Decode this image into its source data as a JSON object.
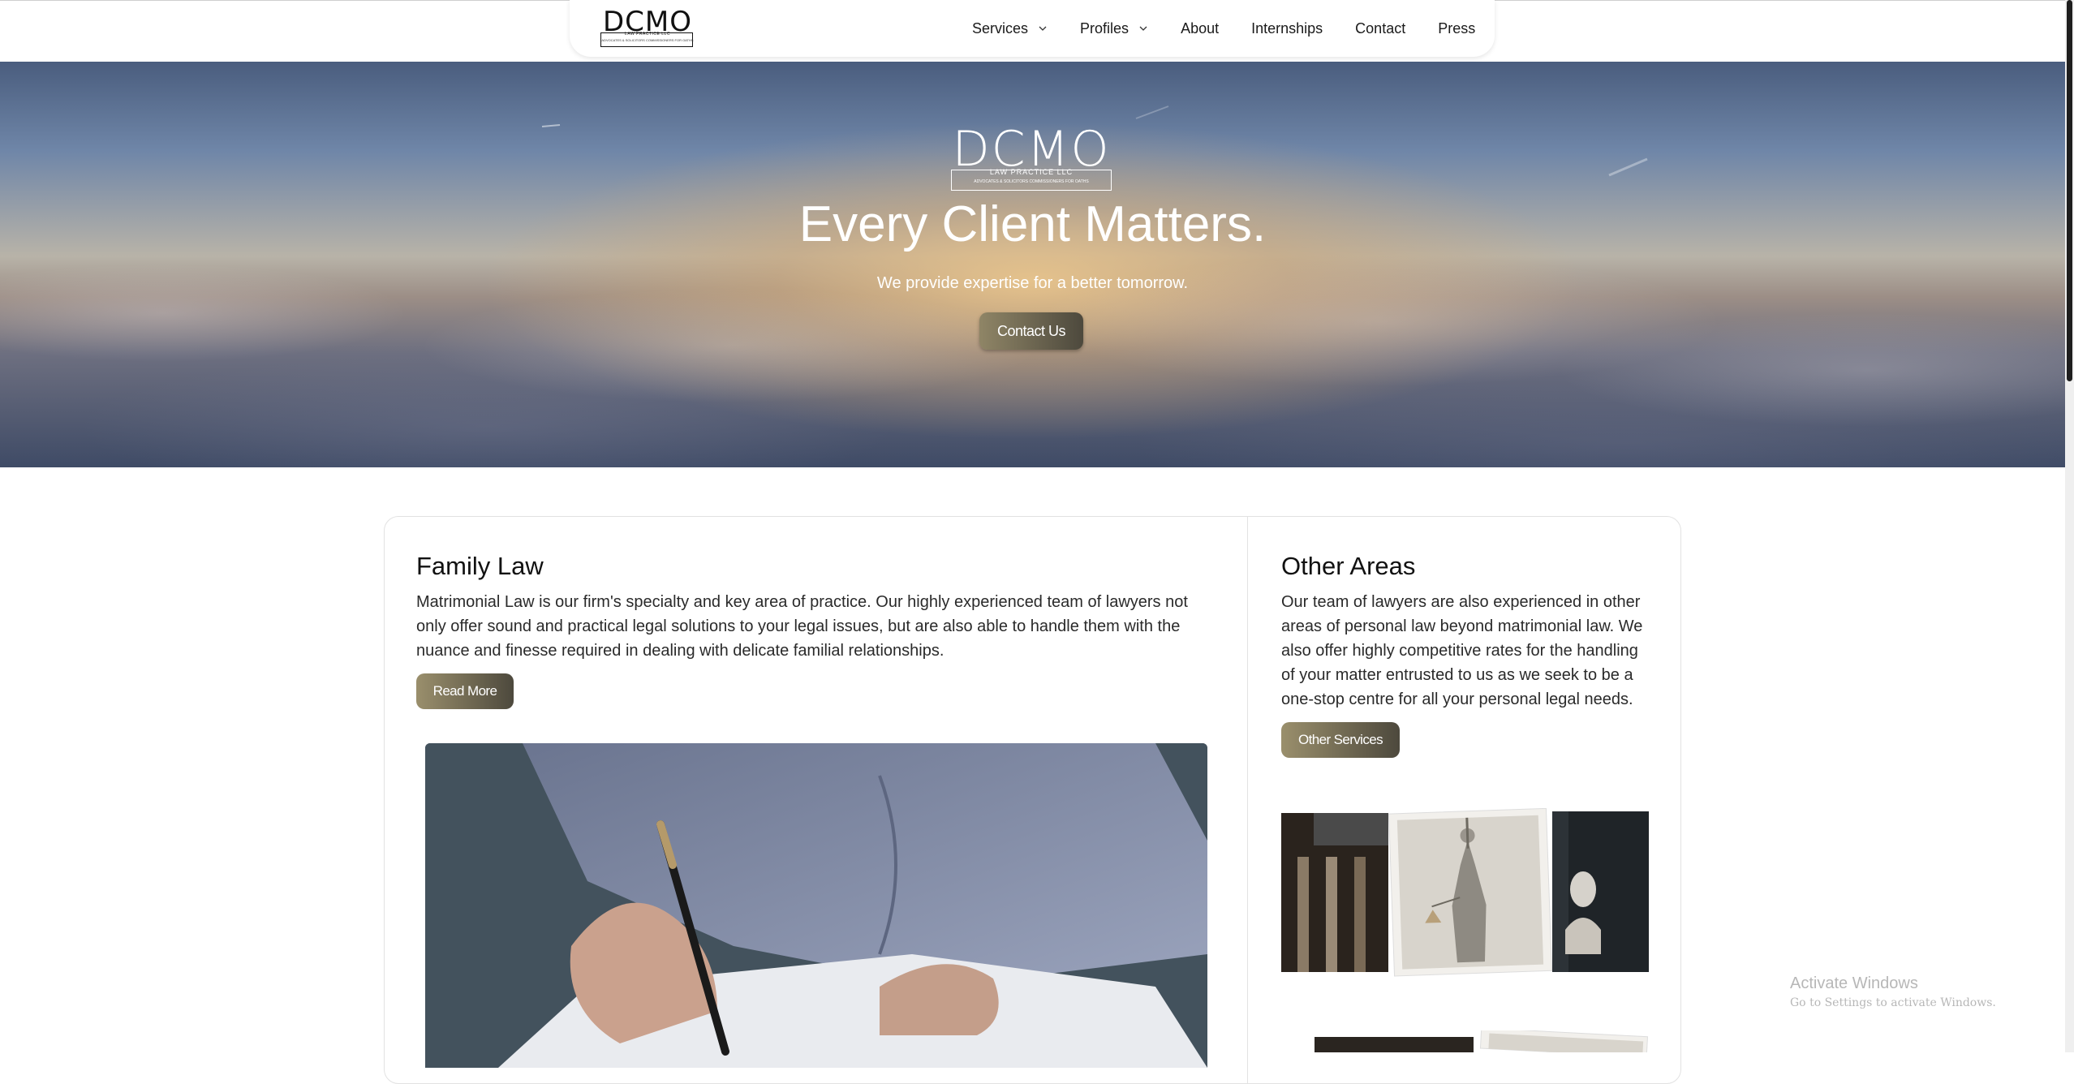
{
  "nav": {
    "logo_text": "DCMO",
    "logo_subtitle": "LAW PRACTICE LLC",
    "logo_tagline": "ADVOCATES & SOLICITORS COMMISSIONERS FOR OATHS",
    "items": [
      {
        "label": "Services",
        "dropdown": true
      },
      {
        "label": "Profiles",
        "dropdown": true
      },
      {
        "label": "About",
        "dropdown": false
      },
      {
        "label": "Internships",
        "dropdown": false
      },
      {
        "label": "Contact",
        "dropdown": false
      },
      {
        "label": "Press",
        "dropdown": false
      }
    ]
  },
  "hero": {
    "logo_text": "DCMO",
    "logo_subtitle": "LAW PRACTICE LLC",
    "logo_tagline": "ADVOCATES & SOLICITORS COMMISSIONERS FOR OATHS",
    "title": "Every Client Matters.",
    "subtitle": "We provide expertise for a better tomorrow.",
    "cta_label": "Contact Us"
  },
  "family_law": {
    "title": "Family Law",
    "body": "Matrimonial Law is our firm's specialty and key area of practice. Our highly experienced team of lawyers not only offer sound and practical legal solutions to your legal issues, but are also able to handle them with the nuance and finesse required in dealing with delicate familial relationships.",
    "button_label": "Read More"
  },
  "other_areas": {
    "title": "Other Areas",
    "body": "Our team of lawyers are also experienced in other areas of personal law beyond matrimonial law. We also offer highly competitive rates for the handling of your matter entrusted to us as we seek to be a one-stop centre for all your personal legal needs.",
    "button_label": "Other Services"
  },
  "watermark": {
    "line1": "Activate Windows",
    "line2": "Go to Settings to activate Windows."
  }
}
